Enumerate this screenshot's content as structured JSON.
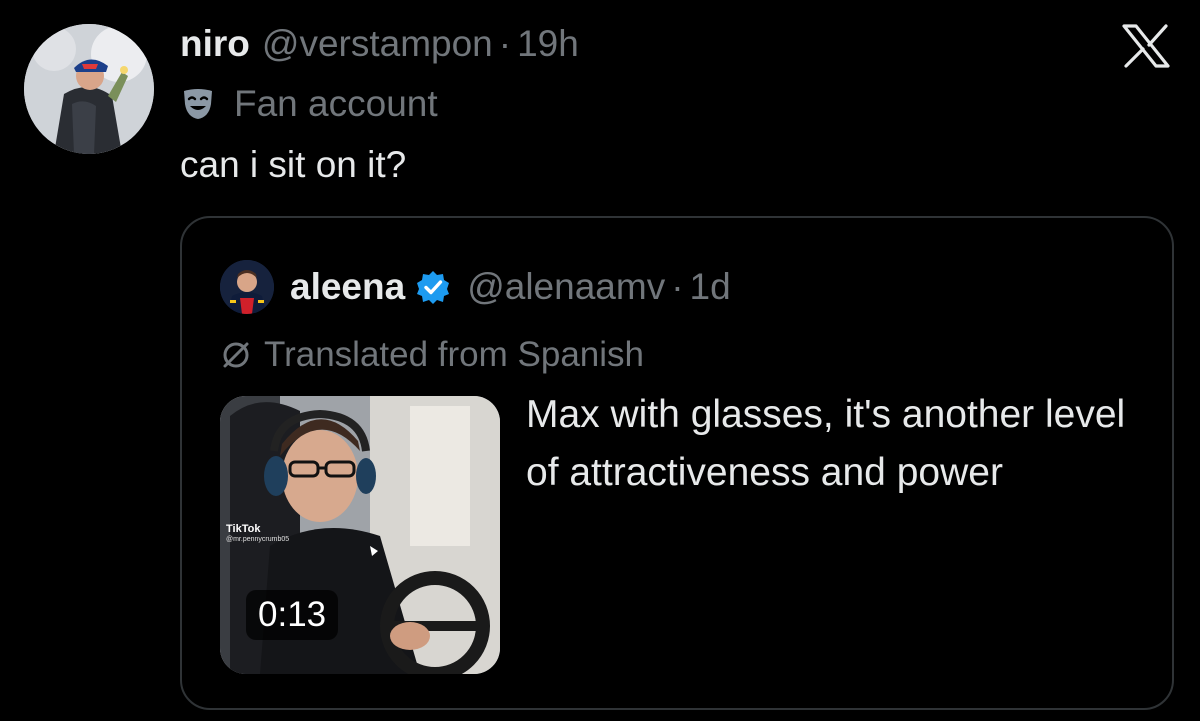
{
  "tweet": {
    "author": {
      "display_name": "niro",
      "handle": "@verstampon",
      "time": "19h",
      "label": "Fan account",
      "label_icon": "theater-mask-icon",
      "avatar_icon": "profile-photo"
    },
    "text": "can i sit on it?",
    "brand_icon": "x-logo-icon"
  },
  "quote": {
    "author": {
      "display_name": "aleena",
      "handle": "@alenaamv",
      "time": "1d",
      "verified": true,
      "verified_color": "#1d9bf0"
    },
    "translated_note": "Translated from Spanish",
    "text": "Max with glasses, it's another level of attractiveness and power",
    "media": {
      "type": "video",
      "duration": "0:13",
      "watermark": "TikTok",
      "watermark_user": "@mr.pennycrumb05"
    }
  },
  "colors": {
    "background": "#000000",
    "primary_text": "#e7e9ea",
    "secondary_text": "#71767b",
    "border": "#2f3336",
    "verified": "#1d9bf0"
  },
  "separator": "·"
}
